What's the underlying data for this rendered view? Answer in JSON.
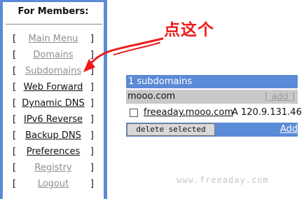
{
  "sidebar": {
    "title": "For Members:",
    "bracket_left": "[",
    "bracket_right": "]",
    "items": [
      {
        "label": "Main Menu"
      },
      {
        "label": "Domains"
      },
      {
        "label": "Subdomains"
      },
      {
        "label": "Web Forward"
      },
      {
        "label": "Dynamic DNS"
      },
      {
        "label": "IPv6 Reverse"
      },
      {
        "label": "Backup DNS"
      },
      {
        "label": "Preferences"
      },
      {
        "label": "Registry"
      },
      {
        "label": "Logout"
      }
    ]
  },
  "annotation": {
    "text": "点这个",
    "color": "#ef1a1a"
  },
  "subdomains_table": {
    "header": "1 subdomains",
    "domain": "mooo.com",
    "add_label": "[ add ]",
    "entries": [
      {
        "name": "freeaday.mooo.com",
        "type": "A",
        "ip": "120.9.131.46"
      }
    ],
    "delete_label": "delete selected",
    "add_link": "Add"
  },
  "watermark": "www.freeaday.com",
  "colors": {
    "accent": "#5b8ad6",
    "row_grey": "#c9c9c9",
    "dim_link": "#8e8e8e"
  }
}
